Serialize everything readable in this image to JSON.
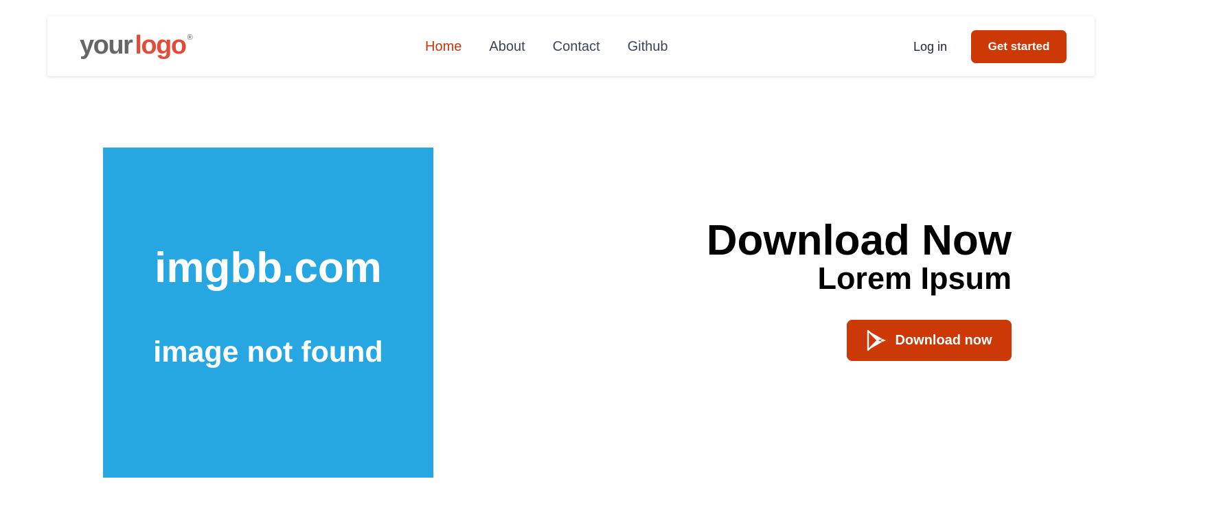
{
  "header": {
    "logo": {
      "part1": "your",
      "part2": "logo",
      "mark": "®"
    },
    "nav": [
      {
        "label": "Home",
        "active": true
      },
      {
        "label": "About",
        "active": false
      },
      {
        "label": "Contact",
        "active": false
      },
      {
        "label": "Github",
        "active": false
      }
    ],
    "login_label": "Log in",
    "cta_label": "Get started"
  },
  "hero": {
    "image": {
      "line1": "imgbb.com",
      "line2": "image not found"
    },
    "title": "Download Now",
    "subtitle": "Lorem Ipsum",
    "button_label": "Download now",
    "button_icon": "google-play-icon"
  },
  "colors": {
    "accent": "#cc3806",
    "nav_text": "#3a4457",
    "image_bg": "#27a7e1",
    "logo_gray": "#666666",
    "logo_red": "#e04e3a"
  }
}
